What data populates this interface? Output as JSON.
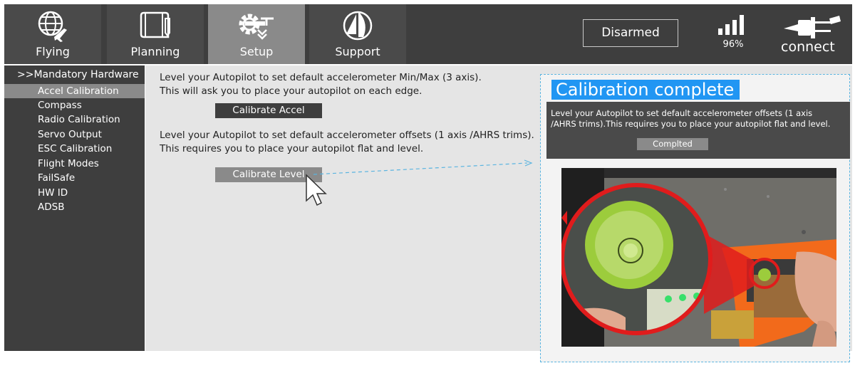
{
  "nav": {
    "tabs": [
      {
        "label": "Flying",
        "icon": "globe-plane-icon",
        "active": false
      },
      {
        "label": "Planning",
        "icon": "map-icon",
        "active": false
      },
      {
        "label": "Setup",
        "icon": "gear-drone-icon",
        "active": true
      },
      {
        "label": "Support",
        "icon": "sail-icon",
        "active": false
      }
    ],
    "arm_status": "Disarmed",
    "signal_percent": "96%",
    "connect_label": "connect"
  },
  "sidebar": {
    "header": ">>Mandatory Hardware",
    "items": [
      {
        "label": "Accel Calibration",
        "active": true
      },
      {
        "label": "Compass"
      },
      {
        "label": "Radio Calibration"
      },
      {
        "label": "Servo Output"
      },
      {
        "label": "ESC Calibration"
      },
      {
        "label": "Flight Modes"
      },
      {
        "label": "FailSafe"
      },
      {
        "label": "HW ID"
      },
      {
        "label": "ADSB"
      }
    ]
  },
  "main": {
    "accel": {
      "line1": "Level your Autopilot to set default accelerometer Min/Max (3 axis).",
      "line2": "This will ask you to place your autopilot on each edge.",
      "button": "Calibrate Accel"
    },
    "level": {
      "line1": "Level your Autopilot to set default accelerometer offsets (1 axis /AHRS trims).",
      "line2": "This requires you to place your autopilot flat and level.",
      "button": "Calibrate Level"
    }
  },
  "callout": {
    "title": "Calibration complete",
    "dialog_line1": "Level your Autopilot to set default accelerometer offsets (1 axis",
    "dialog_line2": "/AHRS trims).This requires you to place your autopilot flat and level.",
    "button": "Complted"
  },
  "colors": {
    "bar": "#3e3e3e",
    "active": "#8a8a8a",
    "accent": "#2196f3",
    "callout_border": "#5ab4e0",
    "highlight_ring": "#e01c1c",
    "bubble_green": "#9ccc3c",
    "frame_orange": "#f26a1b"
  }
}
